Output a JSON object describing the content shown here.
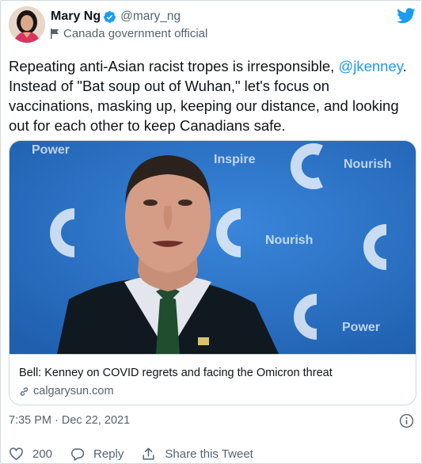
{
  "author": {
    "display_name": "Mary Ng",
    "handle": "@mary_ng",
    "label": "Canada government official"
  },
  "tweet": {
    "text_before": "Repeating anti-Asian racist tropes is irresponsible, ",
    "mention": "@jkenney",
    "text_after": ". Instead of \"Bat soup out of Wuhan,\" let's focus on vaccinations, masking up, keeping our distance, and looking out for each other to keep Canadians safe."
  },
  "card": {
    "title": "Bell: Kenney on COVID regrets and facing the Omicron threat",
    "domain": "calgarysun.com",
    "backdrop_words": [
      "Power",
      "Inspire",
      "Nourish",
      "Nourish",
      "Power"
    ]
  },
  "timestamp": "7:35 PM · Dec 22, 2021",
  "actions": {
    "like_count": "200",
    "reply_label": "Reply",
    "share_label": "Share this Tweet"
  },
  "colors": {
    "accent": "#1d9bf0",
    "secondary_text": "#536471",
    "border": "#cfd9de",
    "backdrop_blue": "#2a72c9"
  },
  "icons": [
    "twitter-bird-icon",
    "verified-badge-icon",
    "flag-icon",
    "link-icon",
    "info-icon",
    "heart-icon",
    "reply-bubble-icon",
    "share-icon"
  ]
}
